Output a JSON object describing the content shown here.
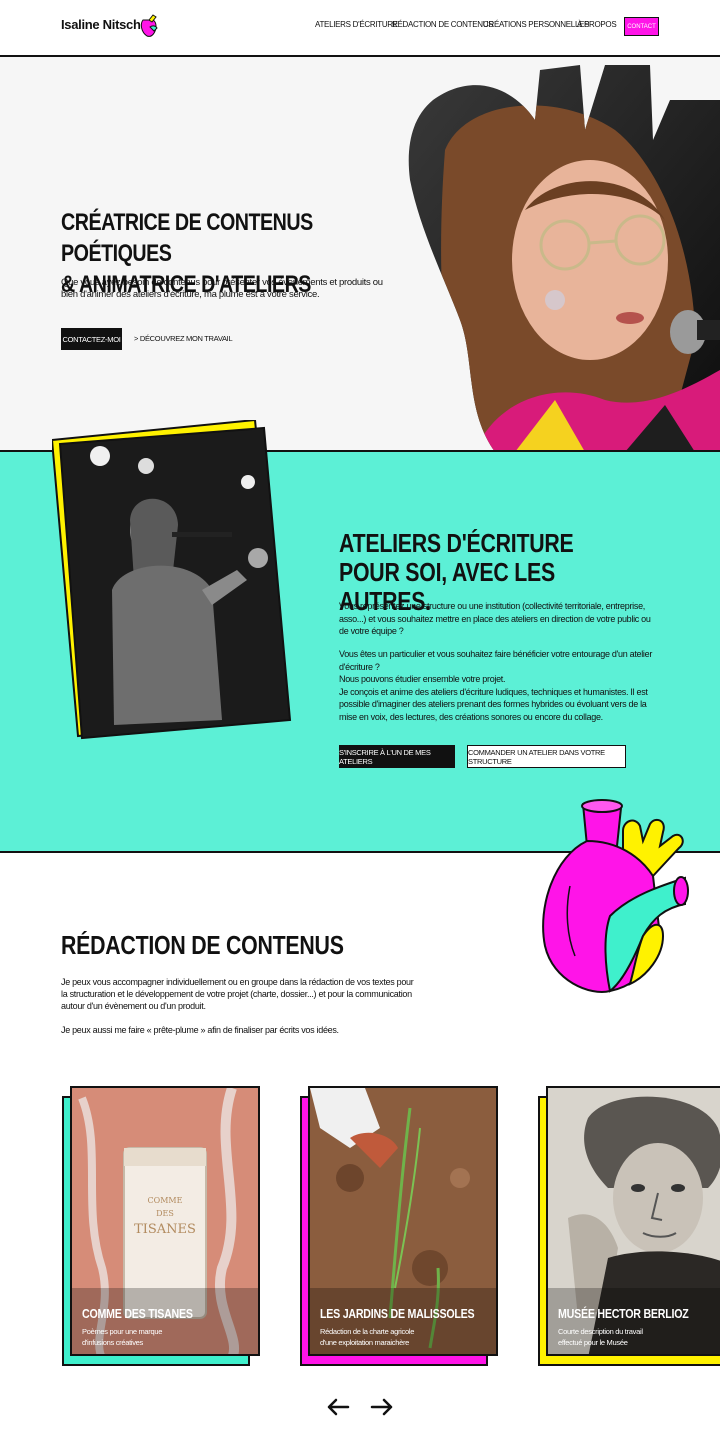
{
  "header": {
    "logo": "Isaline Nitsche",
    "nav": [
      "Ateliers d'écriture",
      "Rédaction de contenus",
      "Créations personnelles",
      "À propos"
    ],
    "contact": "Contact"
  },
  "hero": {
    "title_line1": "Créatrice de contenus poétiques",
    "title_line2": "& animatrice d'ateliers",
    "description": "Que vous ayez besoin de contenus pour présenter vos évenements et produits ou bien d'animer des ateliers d'écriture, ma plume est à votre service.",
    "cta_primary": "Contactez-moi",
    "cta_secondary": "> Découvrez mon travail"
  },
  "ateliers": {
    "title_line1": "Ateliers d'écriture",
    "title_line2": "pour soi, avec les autres.",
    "para1": "Vous représentez une structure ou une institution (collectivité territoriale, entreprise, asso...) et vous souhaitez mettre en place des ateliers en direction de votre public ou de votre équipe ?",
    "para2a": "Vous êtes un particulier et vous souhaitez faire bénéficier votre entourage d'un atelier d'écriture ?",
    "para2b": "Nous pouvons étudier ensemble votre projet.",
    "para2c": "Je conçois et anime des ateliers d'écriture ludiques, techniques et humanistes. Il est possible d'imaginer des ateliers prenant des formes hybrides ou évoluant vers de la mise en voix, des lectures, des créations sonores ou encore du collage.",
    "btn_register": "S'inscrire à l'un de mes ateliers",
    "btn_order": "Commander un atelier dans votre structure"
  },
  "redaction": {
    "title": "Rédaction de contenus",
    "para1": "Je peux vous accompagner individuellement ou en groupe dans la rédaction de vos textes pour la structuration et le développement de votre projet (charte, dossier...) et pour la communication autour d'un évènement ou d'un produit.",
    "para2": "Je peux aussi me faire « prête-plume » afin de finaliser par écrits vos idées."
  },
  "cards": [
    {
      "title": "Comme des tisanes",
      "sub1": "Poèmes pour une marque",
      "sub2": "d'infusions créatives",
      "accent": "#3ff0cc"
    },
    {
      "title": "Les jardins de Malissoles",
      "sub1": "Rédaction de la charte agricole",
      "sub2": "d'une exploitation maraichère",
      "accent": "#ff14e8"
    },
    {
      "title": "Musée Hector Berlioz",
      "sub1": "Courte description du travail",
      "sub2": "effectué pour le Musée",
      "accent": "#fff200"
    }
  ],
  "colors": {
    "magenta": "#ff14e8",
    "teal": "#5cf0d6",
    "yellow": "#fff200",
    "dark": "#111111"
  },
  "icons": {
    "prev": "arrow-left-icon",
    "next": "arrow-right-icon",
    "heart": "anatomical-heart-illustration"
  }
}
